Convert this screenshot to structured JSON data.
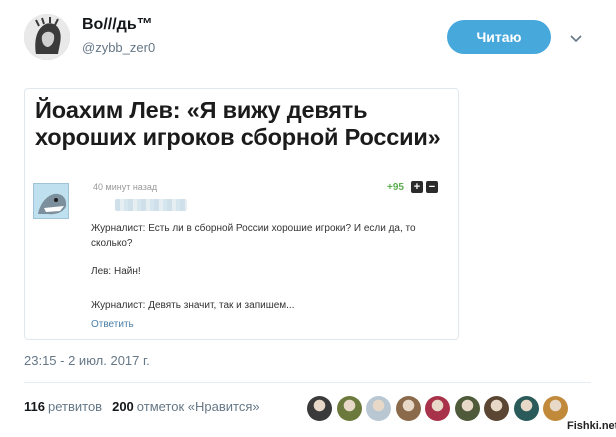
{
  "tweet": {
    "user_name": "Bo///дь™",
    "handle": "@zybb_zer0",
    "follow_label": "Читаю",
    "timestamp": "23:15 - 2 июл. 2017 г.",
    "retweets_count": "116",
    "retweets_label": "ретвитов",
    "likes_count": "200",
    "likes_label": "отметок «Нравится»"
  },
  "card": {
    "title": "Йоахим Лев: «Я вижу девять хороших игроков сборной России»",
    "comment": {
      "time": "40 минут назад",
      "score": "+95",
      "plus": "+",
      "minus": "−",
      "line1": "Журналист: Есть ли в сборной России хорошие игроки? И если да, то сколько?",
      "line2": "Лев: Найн!",
      "line3": "Журналист: Девять значит, так и запишем...",
      "reply": "Ответить"
    }
  },
  "likers": [
    {
      "icon": "liker-avatar-1",
      "color": "#3a3a3a"
    },
    {
      "icon": "liker-avatar-2",
      "color": "#6b7a3c"
    },
    {
      "icon": "liker-avatar-3",
      "color": "#b9c7d3"
    },
    {
      "icon": "liker-avatar-4",
      "color": "#8a6a4a"
    },
    {
      "icon": "liker-avatar-5",
      "color": "#a8324a"
    },
    {
      "icon": "liker-avatar-6",
      "color": "#4f5a3a"
    },
    {
      "icon": "liker-avatar-7",
      "color": "#5a4632"
    },
    {
      "icon": "liker-avatar-8",
      "color": "#2a5a5a"
    },
    {
      "icon": "liker-avatar-9",
      "color": "#c08a3a"
    }
  ],
  "watermark": "Fishki.net",
  "colors": {
    "follow_button": "#47a8dc",
    "text_primary": "#14171a",
    "text_secondary": "#657786",
    "score_green": "#5cae4f"
  }
}
